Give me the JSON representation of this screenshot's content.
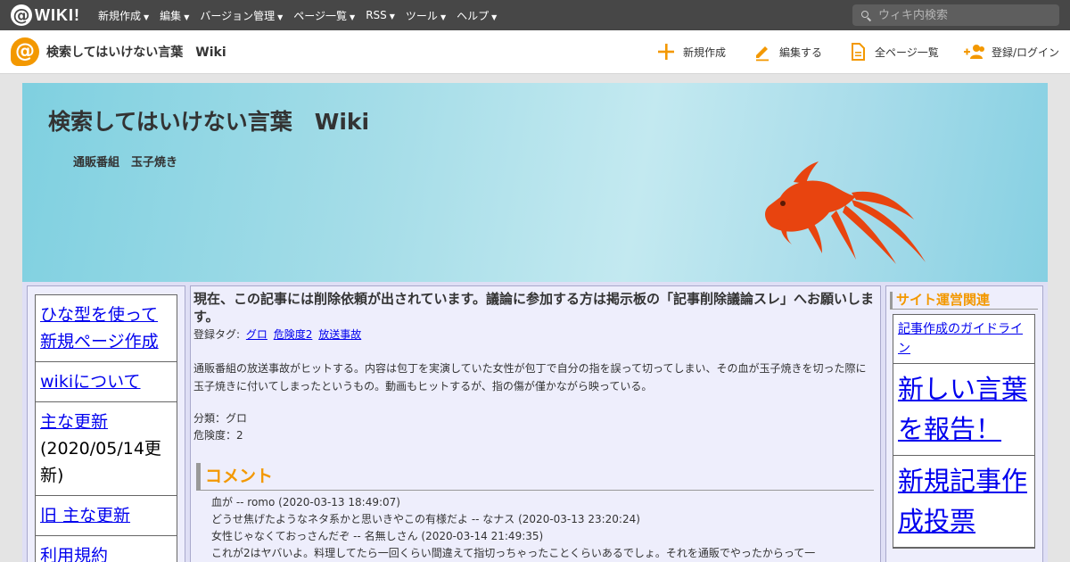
{
  "topbar": {
    "logo_text": "WIKI!",
    "menu": [
      "新規作成",
      "編集",
      "バージョン管理",
      "ページ一覧",
      "RSS",
      "ツール",
      "ヘルプ"
    ],
    "search_placeholder": "ウィキ内検索"
  },
  "subbar": {
    "title": "検索してはいけない言葉　Wiki",
    "actions": [
      "新規作成",
      "編集する",
      "全ページ一覧",
      "登録/ログイン"
    ]
  },
  "banner": {
    "title": "検索してはいけない言葉　Wiki",
    "page_name": "通販番組　玉子焼き"
  },
  "left_nav": {
    "items": [
      {
        "link": "ひな型を使って新規ページ作成",
        "note": ""
      },
      {
        "link": "wikiについて",
        "note": ""
      },
      {
        "link": "主な更新",
        "note": "(2020/05/14更新)"
      },
      {
        "link": "旧 主な更新",
        "note": ""
      },
      {
        "link": "利用規約",
        "note": ""
      }
    ]
  },
  "article": {
    "notice": "現在、この記事には削除依頼が出されています。議論に参加する方は掲示板の「記事削除議論スレ」へお願いします。",
    "tags_label": "登録タグ:",
    "tags": [
      "グロ",
      "危険度2",
      "放送事故"
    ],
    "body": "通販番組の放送事故がヒットする。内容は包丁を実演していた女性が包丁で自分の指を誤って切ってしまい、その血が玉子焼きを切った際に玉子焼きに付いてしまったというもの。動画もヒットするが、指の傷が僅かながら映っている。",
    "category": "分類：グロ",
    "danger": "危険度：2",
    "comments_heading": "コメント",
    "comments": [
      "血が -- romo (2020-03-13 18:49:07)",
      "どうせ焦げたようなネタ系かと思いきやこの有様だよ -- なナス (2020-03-13 23:20:24)",
      "女性じゃなくておっさんだぞ -- 名無しさん (2020-03-14 21:49:35)",
      "これが2はヤバいよ。料理してたら一回くらい間違えて指切っちゃったことくらいあるでしょ。それを通販でやったからって一"
    ]
  },
  "right_sidebar": {
    "heading": "サイト運営関連",
    "items": [
      "記事作成のガイドライン",
      "新しい言葉を報告！",
      "新規記事作成投票"
    ]
  },
  "colors": {
    "accent_orange": "#f39800",
    "goldfish": "#e8440f",
    "link": "#0000ee",
    "topbar": "#474747"
  }
}
